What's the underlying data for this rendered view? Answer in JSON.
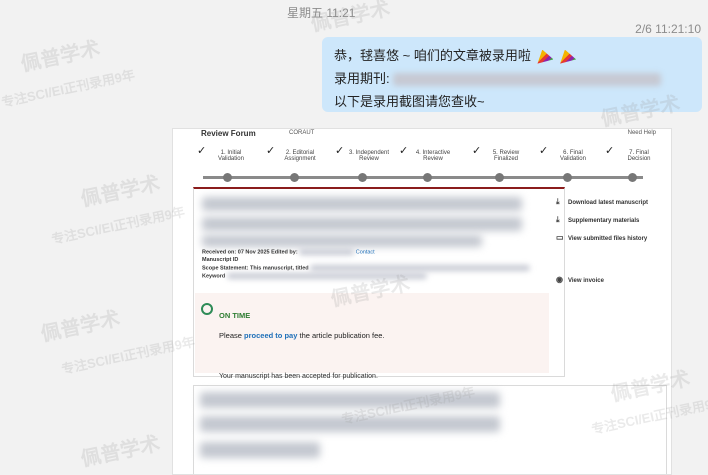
{
  "chat": {
    "center_time": "星期五 11:21",
    "message_time": "2/6 11:21:10",
    "message": {
      "line1_prefix": "恭，毬喜悠",
      "line1_suffix": "~ 咱们的文章被录用啦",
      "line2_label": "录用期刊:",
      "line3": "以下是录用截图请您查收~"
    }
  },
  "screenshot": {
    "forum_title": "Review Forum",
    "code": "CORAUT",
    "help": "Need Help",
    "steps": [
      {
        "label1": "1. Initial",
        "label2": "Validation"
      },
      {
        "label1": "2. Editorial",
        "label2": "Assignment"
      },
      {
        "label1": "3. Independent",
        "label2": "Review"
      },
      {
        "label1": "4. Interactive",
        "label2": "Review"
      },
      {
        "label1": "5. Review",
        "label2": "Finalized"
      },
      {
        "label1": "6. Final",
        "label2": "Validation"
      },
      {
        "label1": "7. Final",
        "label2": "Decision"
      }
    ],
    "received": "Received on: 07 Nov 2025 Edited by:",
    "contact": "Contact",
    "manuscript_id": "Manuscript ID",
    "scope": "Scope Statement: This manuscript, titled",
    "keywords": "Keyword",
    "side": {
      "download": "Download latest manuscript",
      "supplementary": "Supplementary materials",
      "view_files": "View submitted files history",
      "view_invoice": "View invoice"
    },
    "ontime": {
      "title": "ON TIME",
      "please": "Please",
      "pay_link": "proceed to pay",
      "pay_rest": "the article publication fee.",
      "accepted": "Your manuscript has been accepted for publication."
    }
  },
  "watermark": {
    "brand": "佩普学术",
    "tagline": "专注SCI/EI正刊录用9年"
  }
}
